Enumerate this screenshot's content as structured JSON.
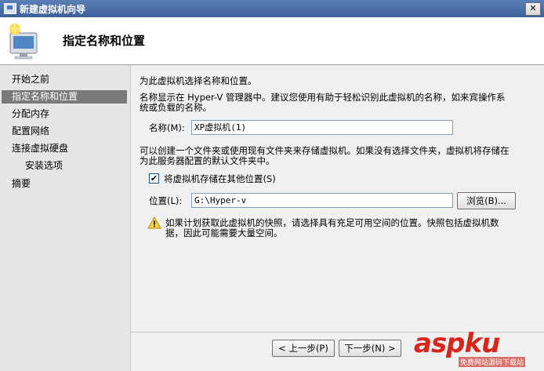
{
  "window": {
    "title": "新建虚拟机向导",
    "close_glyph": "✕"
  },
  "header": {
    "title": "指定名称和位置"
  },
  "nav": {
    "items": [
      {
        "label": "开始之前"
      },
      {
        "label": "指定名称和位置"
      },
      {
        "label": "分配内存"
      },
      {
        "label": "配置网络"
      },
      {
        "label": "连接虚拟硬盘"
      },
      {
        "label": "安装选项"
      },
      {
        "label": "摘要"
      }
    ],
    "selected": "指定名称和位置"
  },
  "main": {
    "intro": "为此虚拟机选择名称和位置。",
    "desc_line1": "名称显示在 Hyper-V 管理器中。建议您使用有助于轻松识别此虚拟机的名称，如来宾操作系",
    "desc_line2": "统或负载的名称。",
    "name_label": "名称(M):",
    "name_value": "XP虚拟机(1)",
    "folder_line1": "可以创建一个文件夹或使用现有文件夹来存储虚拟机。如果没有选择文件夹，虚拟机将存储在",
    "folder_line2": "为此服务器配置的默认文件夹中。",
    "store_checkbox_label": "将虚拟机存储在其他位置(S)",
    "store_checked": true,
    "check_glyph": "✔",
    "location_label": "位置(L):",
    "location_value": "G:\\Hyper-v",
    "browse_label": "浏览(B)...",
    "warning_line1": "如果计划获取此虚拟机的快照，请选择具有充足可用空间的位置。快照包括虚拟机数",
    "warning_line2": "据，因此可能需要大量空间。"
  },
  "footer": {
    "prev_label": "< 上一步(P)",
    "next_label": "下一步(N) >"
  },
  "watermark": {
    "text": "aspku",
    "sub": "免费网站源码下载站"
  },
  "colors": {
    "titlebar": "#3d6098",
    "nav_selected": "#7a7a7a",
    "watermark": "#d8261c"
  }
}
